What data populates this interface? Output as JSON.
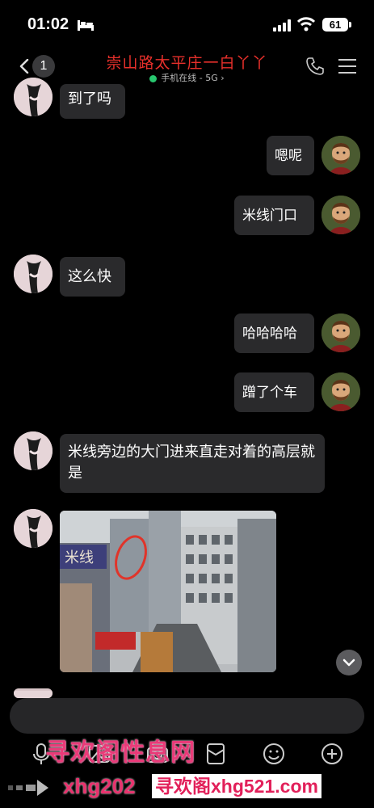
{
  "status_bar": {
    "time": "01:02",
    "battery": "61"
  },
  "header": {
    "unread_count": "1",
    "title": "崇山路太平庄一白丫丫",
    "online_status": "手机在线 - 5G",
    "online_chevron": "›"
  },
  "messages": [
    {
      "side": "left",
      "type": "text",
      "text": "到了吗"
    },
    {
      "side": "right",
      "type": "text",
      "text": "嗯呢"
    },
    {
      "side": "right",
      "type": "text",
      "text": "米线门口"
    },
    {
      "side": "left",
      "type": "text",
      "text": "这么快"
    },
    {
      "side": "right",
      "type": "text",
      "text": "哈哈哈哈"
    },
    {
      "side": "right",
      "type": "text",
      "text": "蹭了个车"
    },
    {
      "side": "left",
      "type": "text",
      "text": "米线旁边的大门进来直走对着的高层就是"
    },
    {
      "side": "left",
      "type": "image",
      "description_text": "米线"
    }
  ],
  "watermark": {
    "line1": "寻欢阁性息网",
    "line2": "xhg202",
    "line3": "寻欢阁xhg521.com"
  },
  "colors": {
    "title": "#e8302b",
    "online_dot": "#28c76f",
    "bubble": "#2a2a2c",
    "watermark": "#e93a78"
  },
  "icons": {
    "nav": [
      "back-chevron-icon",
      "phone-icon",
      "menu-icon"
    ],
    "toolbar": [
      "microphone-icon",
      "image-icon",
      "camera-icon",
      "red-packet-icon",
      "emoji-icon",
      "plus-icon"
    ]
  }
}
